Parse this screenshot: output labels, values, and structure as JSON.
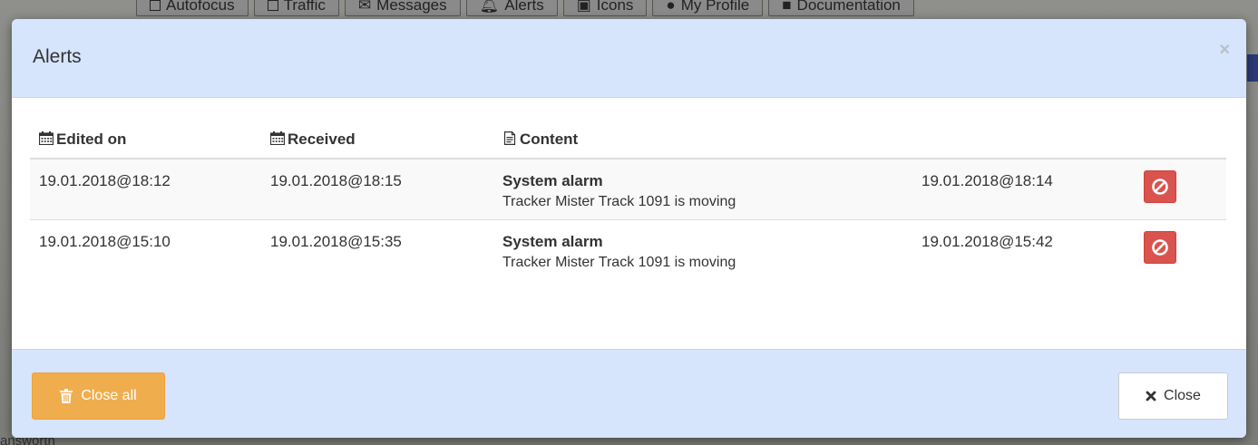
{
  "background": {
    "toolbar": [
      {
        "label": "Autofocus",
        "icon": "checkbox-icon"
      },
      {
        "label": "Traffic",
        "icon": "checkbox-icon"
      },
      {
        "label": "Messages",
        "icon": "envelope-icon"
      },
      {
        "label": "Alerts",
        "icon": "bell-icon"
      },
      {
        "label": "Icons",
        "icon": "image-icon"
      },
      {
        "label": "My Profile",
        "icon": "user-icon"
      },
      {
        "label": "Documentation",
        "icon": "book-icon"
      }
    ],
    "map_text": "answorth"
  },
  "modal": {
    "title": "Alerts",
    "close_symbol": "×",
    "table": {
      "headers": [
        {
          "label": "Edited on",
          "icon": "calendar-icon"
        },
        {
          "label": "Received",
          "icon": "calendar-icon"
        },
        {
          "label": "Content",
          "icon": "document-icon"
        }
      ],
      "rows": [
        {
          "edited_on": "19.01.2018@18:12",
          "received": "19.01.2018@18:15",
          "content_title": "System alarm",
          "content_text": "Tracker Mister Track 1091 is moving",
          "timestamp": "19.01.2018@18:14"
        },
        {
          "edited_on": "19.01.2018@15:10",
          "received": "19.01.2018@15:35",
          "content_title": "System alarm",
          "content_text": "Tracker Mister Track 1091 is moving",
          "timestamp": "19.01.2018@15:42"
        }
      ]
    },
    "footer": {
      "close_all_label": "Close all",
      "close_label": "Close"
    }
  },
  "colors": {
    "header_bg": "#d6e4fc",
    "danger": "#d9534f",
    "warning": "#f0ad4e"
  }
}
